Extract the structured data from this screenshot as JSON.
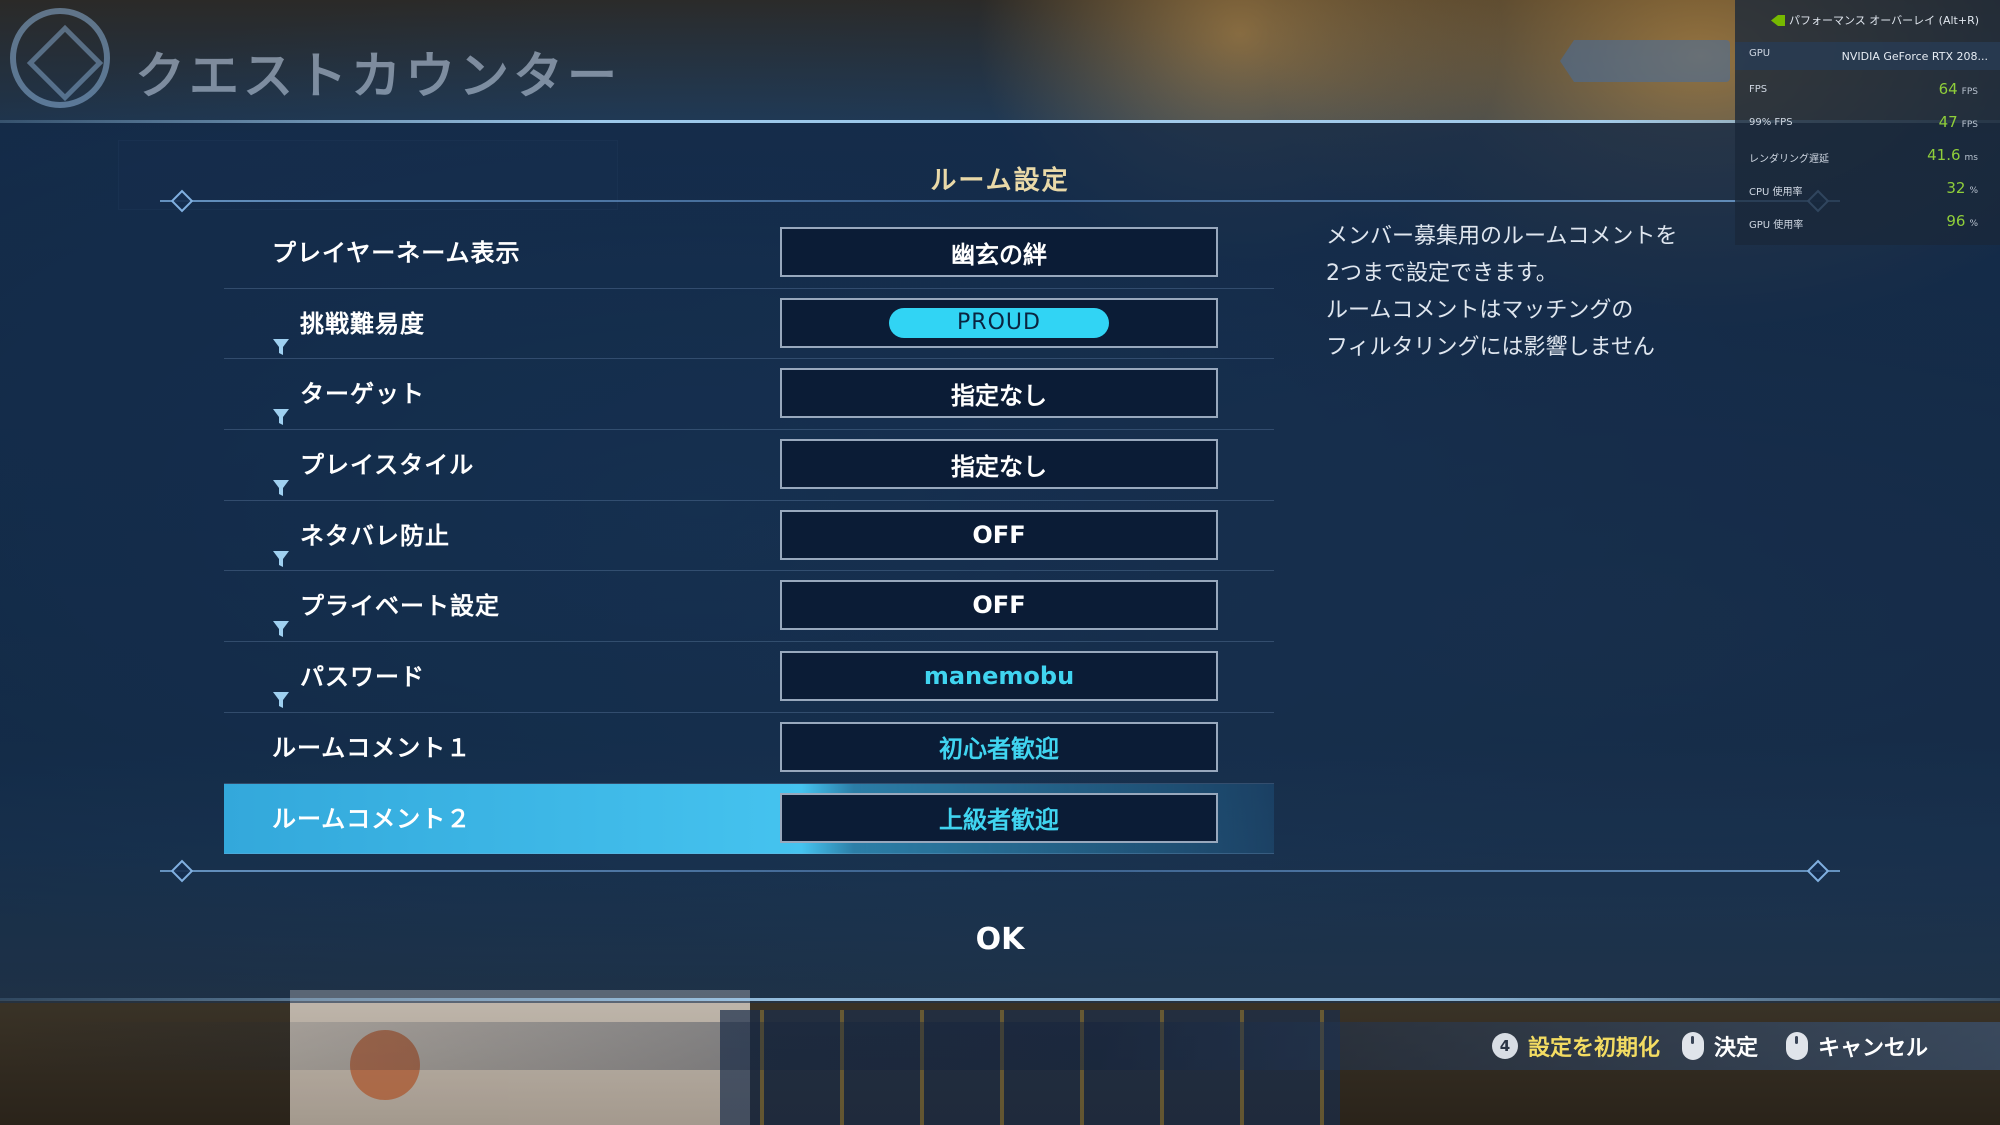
{
  "header": {
    "title": "クエストカウンター"
  },
  "panel": {
    "title": "ルーム設定",
    "rows": [
      {
        "label": "プレイヤーネーム表示",
        "value": "幽玄の絆",
        "filter": false,
        "style": "plain"
      },
      {
        "label": "挑戦難易度",
        "value": "PROUD",
        "filter": true,
        "style": "pill"
      },
      {
        "label": "ターゲット",
        "value": "指定なし",
        "filter": true,
        "style": "plain"
      },
      {
        "label": "プレイスタイル",
        "value": "指定なし",
        "filter": true,
        "style": "plain"
      },
      {
        "label": "ネタバレ防止",
        "value": "OFF",
        "filter": true,
        "style": "plain"
      },
      {
        "label": "プライベート設定",
        "value": "OFF",
        "filter": true,
        "style": "plain"
      },
      {
        "label": "パスワード",
        "value": "manemobu",
        "filter": true,
        "style": "cyan"
      },
      {
        "label": "ルームコメント１",
        "value": "初心者歓迎",
        "filter": false,
        "style": "cyan"
      },
      {
        "label": "ルームコメント２",
        "value": "上級者歓迎",
        "filter": false,
        "style": "cyan",
        "selected": true
      }
    ],
    "description": [
      "メンバー募集用のルームコメントを",
      "2つまで設定できます。",
      "ルームコメントはマッチングの",
      "フィルタリングには影響しません"
    ],
    "ok_label": "OK"
  },
  "bottom_bar": {
    "reset": {
      "key": "4",
      "label": "設定を初期化"
    },
    "confirm": {
      "label": "決定"
    },
    "cancel": {
      "label": "キャンセル"
    }
  },
  "performance_overlay": {
    "title": "パフォーマンス オーバーレイ (Alt+R)",
    "gpu": {
      "label": "GPU",
      "value": "NVIDIA GeForce RTX 208..."
    },
    "metrics": [
      {
        "label": "FPS",
        "value": "64",
        "unit": "FPS"
      },
      {
        "label": "99% FPS",
        "value": "47",
        "unit": "FPS"
      },
      {
        "label": "レンダリング遅延",
        "value": "41.6",
        "unit": "ms"
      },
      {
        "label": "CPU 使用率",
        "value": "32",
        "unit": "%"
      },
      {
        "label": "GPU 使用率",
        "value": "96",
        "unit": "%"
      }
    ]
  },
  "colors": {
    "accent_cyan": "#40d4f0",
    "selected_row": "#45c3ef",
    "title_gold": "#e9d9a8",
    "hint_yellow": "#f3dc62",
    "perf_green": "#8fce3a"
  }
}
